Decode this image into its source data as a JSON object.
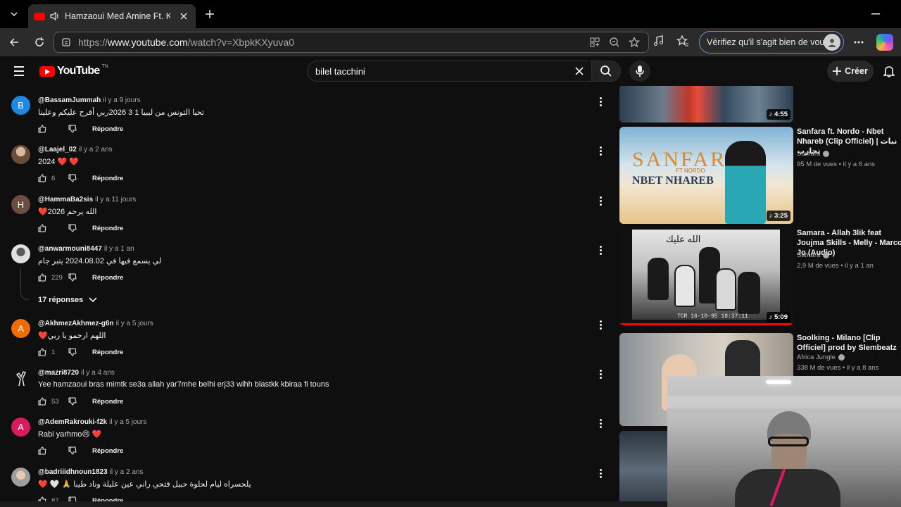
{
  "browser": {
    "tab_title": "Hamzaoui Med Amine Ft. KAF",
    "url_prefix": "https://",
    "url_host": "www.youtube.com",
    "url_path": "/watch?v=XbpkKXyuva0",
    "verify_label": "Vérifiez qu'il s'agit bien de vous"
  },
  "youtube": {
    "logo_text": "YouTube",
    "country_code": "TN",
    "search_value": "bilel tacchini",
    "create_label": "Créer"
  },
  "comments": [
    {
      "author": "@BassamJummah",
      "date": "il y a 9 jours",
      "text": "تحيا التونس من ليبيا 1 3 2026ربي أفرح عليكم وعلينا",
      "likes": "",
      "reply_label": "Répondre",
      "avatar_letter": "B",
      "avatar_color": "#1e88e5"
    },
    {
      "author": "@Laajel_02",
      "date": "il y a 2 ans",
      "text": "2024 ❤️ ❤️",
      "likes": "6",
      "reply_label": "Répondre",
      "avatar_letter": "",
      "avatar_color": "#8a6a55"
    },
    {
      "author": "@HammaBa2sis",
      "date": "il y a 11 jours",
      "text": "❤️2026 الله يرحم",
      "likes": "",
      "reply_label": "Répondre",
      "avatar_letter": "H",
      "avatar_color": "#6d4c41"
    },
    {
      "author": "@anwarmouni8447",
      "date": "il y a 1 an",
      "text": "لي يسمع فيها في 2024.08.02 يتبر جام",
      "likes": "229",
      "reply_label": "Répondre",
      "avatar_letter": "",
      "avatar_color": "#9e9e9e"
    },
    {
      "author": "@AkhmezAkhmez-g6n",
      "date": "il y a 5 jours",
      "text": "❤️اللهم ارحمو يا ربي",
      "likes": "1",
      "reply_label": "Répondre",
      "avatar_letter": "A",
      "avatar_color": "#ef6c00"
    },
    {
      "author": "@mazri8720",
      "date": "il y a 4 ans",
      "text": "Yee hamzaoui bras mimtk se3a allah yar7mhe belhi erj33 wlhh blastkk kbiraa fi touns",
      "likes": "53",
      "reply_label": "Répondre",
      "avatar_letter": "",
      "avatar_color": "#ffffff"
    },
    {
      "author": "@AdemRakrouki-f2k",
      "date": "il y a 5 jours",
      "text": "Rabi yarhmo😢 ❤️",
      "likes": "",
      "reply_label": "Répondre",
      "avatar_letter": "A",
      "avatar_color": "#d81b60"
    },
    {
      "author": "@badriiidhnoun1823",
      "date": "il y a 2 ans",
      "text": "❤️ 🤍 🙏 يلحسراه ليام لحلوة حبيل فتحي راني عين عليلة وناد طيبا",
      "likes": "87",
      "reply_label": "Répondre",
      "avatar_letter": "",
      "avatar_color": "#bdbdbd"
    }
  ],
  "replies_toggle": "17 réponses",
  "recommendations": [
    {
      "title": "",
      "channel": "",
      "meta": "",
      "duration": "4:55"
    },
    {
      "title": "Sanfara ft. Nordo - Nbet Nhareb (Clip Officiel) | نبات نحارب",
      "channel": "Sanfara",
      "meta": "95 M de vues • il y a 6 ans",
      "duration": "3:25",
      "thumb_text": "SANFARA",
      "thumb_sub": "FT NORDO",
      "thumb_title": "NBET NHAREB"
    },
    {
      "title": "Samara - Allah 3lik feat Joujma Skills - Melly - Marco - Jo (Audio)",
      "channel": "Samara",
      "meta": "2,9 M de vues • il y a 1 an",
      "duration": "5:09",
      "thumb_text": "الله عليك",
      "thumb_sub": "TCR 16-10-95 18:37:11"
    },
    {
      "title": "Soolking - Milano [Clip Officiel] prod by Slembeatz",
      "channel": "Africa Jungle",
      "meta": "338 M de vues • il y a 8 ans",
      "duration": ""
    }
  ],
  "colors": {
    "accent_red": "#ff0000",
    "bg": "#0f0f0f"
  }
}
